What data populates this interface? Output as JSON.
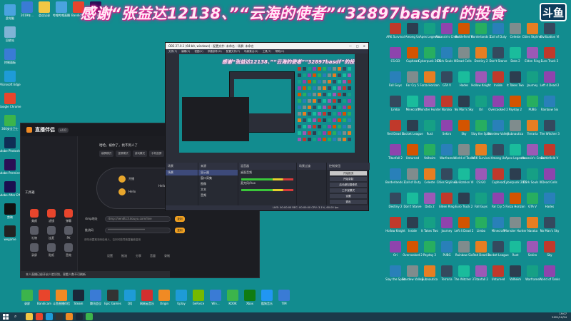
{
  "overlay": {
    "thanks_text": "感谢“张益达12138、”“云海的使者”“32897basdf”的投食",
    "room_logo": "斗鱼"
  },
  "desktop_left": [
    {
      "label": "此电脑",
      "icon": "pc-icon",
      "color": "#4aa3df"
    },
    {
      "label": "回收站",
      "icon": "recycle-bin-icon",
      "color": "#7fb3d5"
    },
    {
      "label": "控制面板",
      "icon": "control-panel-icon",
      "color": "#3a7bd5"
    },
    {
      "label": "Microsoft Edge",
      "icon": "edge-icon",
      "color": "#1e9bd7"
    },
    {
      "label": "Google Chrome",
      "icon": "chrome-icon",
      "color": "#e8452c"
    },
    {
      "label": "360安全卫士",
      "icon": "shield-icon",
      "color": "#3cb44b"
    },
    {
      "label": "Adobe Photoshop",
      "icon": "ps-icon",
      "color": "#0f2e55"
    },
    {
      "label": "Adobe Premiere",
      "icon": "pr-icon",
      "color": "#2a0f55"
    },
    {
      "label": "Adobe After Effects 2020",
      "icon": "ae-icon",
      "color": "#1a1050"
    },
    {
      "label": "剪映",
      "icon": "capcut-icon",
      "color": "#111111"
    },
    {
      "label": "wegame",
      "icon": "wegame-icon",
      "color": "#222222"
    }
  ],
  "desktop_top": [
    {
      "label": "2019年...",
      "color": "#3a7bd5"
    },
    {
      "label": "会议记录",
      "color": "#f2c744"
    },
    {
      "label": "哔哩哔哩直播",
      "color": "#4aa3df"
    },
    {
      "label": "Bandicam",
      "color": "#e8452c"
    },
    {
      "label": "Adobe Premiere Pro",
      "color": "#2a0f55"
    },
    {
      "label": "录屏",
      "color": "#3cb44b"
    },
    {
      "label": "Bandicam",
      "color": "#e8452c"
    },
    {
      "label": "斗鱼直播伴侣",
      "color": "#f08a24"
    },
    {
      "label": "Steam",
      "color": "#1b2838"
    },
    {
      "label": "腾讯会议",
      "color": "#3a7bd5"
    },
    {
      "label": "Epic Games",
      "color": "#333333"
    },
    {
      "label": "QQ",
      "color": "#1e9bd7"
    },
    {
      "label": "网易云音乐",
      "color": "#d32f2f"
    },
    {
      "label": "Origin",
      "color": "#f08a24"
    },
    {
      "label": "Uplay",
      "color": "#1e9bd7"
    },
    {
      "label": "GeForce",
      "color": "#76b900"
    },
    {
      "label": "Win...",
      "color": "#3a7bd5"
    },
    {
      "label": "KOOK",
      "color": "#3cb44b"
    },
    {
      "label": "Xbox",
      "color": "#107c10"
    },
    {
      "label": "酷狗音乐",
      "color": "#2196f3"
    },
    {
      "label": "TIM",
      "color": "#3a7bd5"
    }
  ],
  "desktop_right_labels": [
    "ARK Survival",
    "Among Us",
    "Apex Legends",
    "Assassin's Creed",
    "Battlefield V",
    "Borderlands 3",
    "Call of Duty",
    "Celeste",
    "Cities Skylines",
    "Civilization VI",
    "CS:GO",
    "Cuphead",
    "Cyberpunk 2077",
    "Dark Souls III",
    "Dead Cells",
    "Destiny 2",
    "Don't Starve",
    "Dota 2",
    "Elden Ring",
    "Euro Truck 2",
    "Fall Guys",
    "Far Cry 5",
    "Forza Horizon",
    "GTA V",
    "Hades",
    "Hollow Knight",
    "Inside",
    "It Takes Two",
    "Journey",
    "Left 4 Dead 2",
    "Limbo",
    "Minecraft",
    "Monster Hunter",
    "Naraka",
    "No Man's Sky",
    "Ori",
    "Overcooked 2",
    "Payday 2",
    "PUBG",
    "Rainbow Six",
    "Red Dead 2",
    "Rocket League",
    "Rust",
    "Sekiro",
    "Sky",
    "Slay the Spire",
    "Stardew Valley",
    "Subnautica",
    "Terraria",
    "The Witcher 3",
    "Titanfall 2",
    "Unturned",
    "Valheim",
    "Warframe",
    "World of Tanks"
  ],
  "helper": {
    "brand": "直播伴侣",
    "version": "v4.0",
    "message": "哈哈，被你了，找不到人了",
    "tabs": [
      "横屏模式",
      "竖屏模式",
      "游戏模式",
      "手机投屏",
      "摄像头"
    ],
    "ctrl_label": "CtRl键盘",
    "node_a": "开播",
    "node_b": "Hello 你好 我的主播",
    "node_c": "Hello",
    "section_title": "工具箱",
    "tools": [
      "美颜",
      "滤镜",
      "弹幕",
      "礼物",
      "连麦",
      "PK",
      "录屏",
      "贴纸",
      "音效"
    ],
    "rtmp_label": "rtmp地址",
    "rtmp_value": "rtmp://sendtc3.douyu.com/live",
    "rtmp_btn": "复制",
    "key_label": "推流码",
    "key_value": "**************************",
    "key_btn": "复制",
    "hint": "请勿泄露推流码给他人，否则可能导致直播被盗用",
    "bottom_tools": [
      "设置",
      "推流",
      "分享",
      "音量",
      "录制"
    ],
    "notice": "本人直播已经开启人脸识别，观看人数不可刷新"
  },
  "obs": {
    "title": "OBS 27.0.1 (64-bit, windows) - 配置文件: 未命名 - 场景: 未命名",
    "menu": [
      "文件(F)",
      "编辑(E)",
      "视图(V)",
      "停靠部件(D)",
      "配置文件(P)",
      "场景集合(S)",
      "工具(T)",
      "帮助(H)"
    ],
    "nested_banner": "感谢“张益达12138、”“云海的使者”“32897basdf”的投食",
    "scenes_header": "场景",
    "scenes": [
      "场景"
    ],
    "sources_header": "来源",
    "sources": [
      "显示器",
      "窗口采集",
      "图像",
      "文本",
      "音频"
    ],
    "mixer_header": "混音器",
    "mixer": [
      "桌面音频",
      "麦克风/Aux"
    ],
    "transitions_header": "场景过渡",
    "controls_header": "控制按钮",
    "controls": [
      "开始推流",
      "开始录制",
      "启动虚拟摄像机",
      "工作室模式",
      "设置",
      "退出"
    ],
    "status": "LIVE: 00:00:00   REC: 00:00:00   CPU: 3.1%, 60.00 fps"
  },
  "taskbar": {
    "apps": [
      "文件资源管理器",
      "Chrome",
      "QQ",
      "OBS",
      "斗鱼直播伴侣",
      "Steam",
      "微信"
    ],
    "time": "19:07",
    "date": "2021/10/24"
  }
}
